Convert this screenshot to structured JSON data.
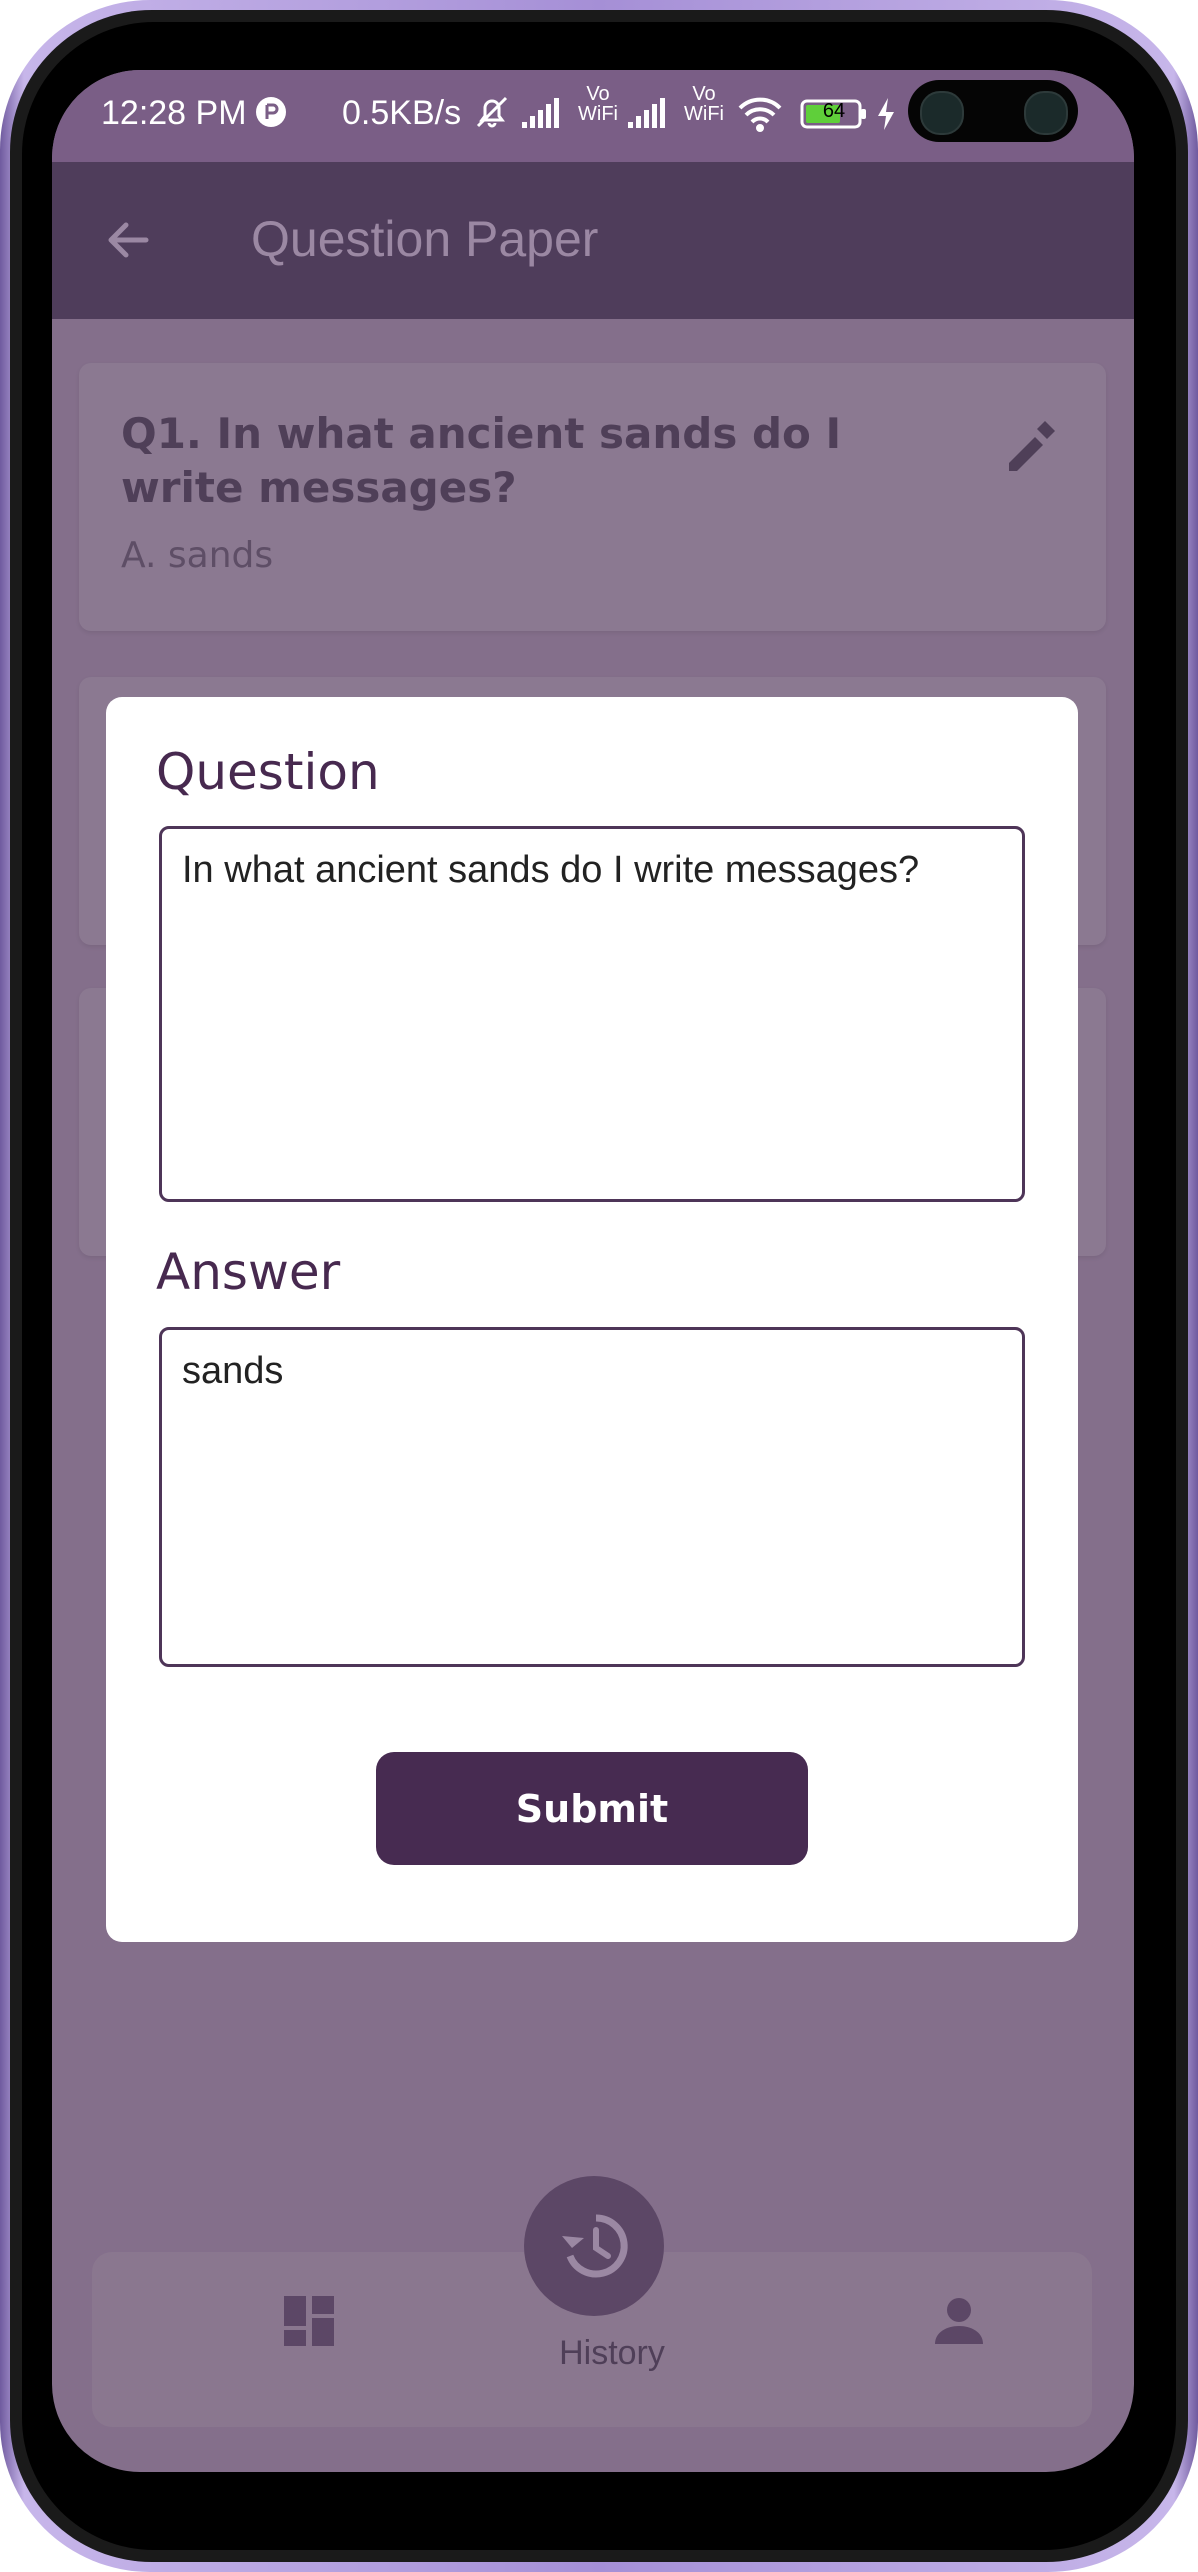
{
  "status_bar": {
    "time": "12:28 PM",
    "network_speed": "0.5KB/s",
    "battery": "64",
    "volte_1": "Vo WiFi",
    "volte_2": "Vo WiFi"
  },
  "app_bar": {
    "title": "Question Paper"
  },
  "question_cards": [
    {
      "question": "Q1. In what ancient sands do I write messages?",
      "answer": "A. sands"
    }
  ],
  "dialog": {
    "question_label": "Question",
    "question_value": "In what ancient sands do I write messages?",
    "answer_label": "Answer",
    "answer_value": "sands",
    "submit_label": "Submit"
  },
  "bottom_nav": {
    "center_label": "History"
  },
  "colors": {
    "primary": "#472b51",
    "scrim": "#846f8b",
    "appbar": "#4f3d5b"
  }
}
